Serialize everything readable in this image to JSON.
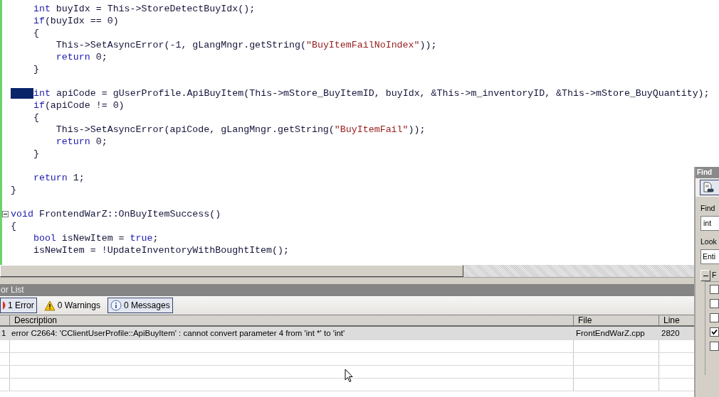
{
  "editor": {
    "lines": [
      {
        "segments": [
          {
            "kind": "keyword",
            "text": "    int"
          },
          {
            "kind": "plain",
            "text": " buyIdx = This->StoreDetectBuyIdx();"
          }
        ]
      },
      {
        "segments": [
          {
            "kind": "keyword",
            "text": "    if"
          },
          {
            "kind": "plain",
            "text": "(buyIdx == 0)"
          }
        ]
      },
      {
        "segments": [
          {
            "kind": "plain",
            "text": "    {"
          }
        ]
      },
      {
        "segments": [
          {
            "kind": "plain",
            "text": "        This->SetAsyncError(-1, gLangMngr.getString("
          },
          {
            "kind": "string",
            "text": "\"BuyItemFailNoIndex\""
          },
          {
            "kind": "plain",
            "text": "));"
          }
        ]
      },
      {
        "segments": [
          {
            "kind": "keyword",
            "text": "        return"
          },
          {
            "kind": "plain",
            "text": " 0;"
          }
        ]
      },
      {
        "segments": [
          {
            "kind": "plain",
            "text": "    }"
          }
        ]
      },
      {
        "kind": "blank"
      },
      {
        "selection": true,
        "segments": [
          {
            "kind": "keyword",
            "text": "int"
          },
          {
            "kind": "plain",
            "text": " apiCode = gUserProfile.ApiBuyItem(This->mStore_BuyItemID, buyIdx, &This->m_inventoryID, &This->mStore_BuyQuantity);"
          }
        ]
      },
      {
        "segments": [
          {
            "kind": "keyword",
            "text": "    if"
          },
          {
            "kind": "plain",
            "text": "(apiCode != 0)"
          }
        ]
      },
      {
        "segments": [
          {
            "kind": "plain",
            "text": "    {"
          }
        ]
      },
      {
        "segments": [
          {
            "kind": "plain",
            "text": "        This->SetAsyncError(apiCode, gLangMngr.getString("
          },
          {
            "kind": "string",
            "text": "\"BuyItemFail\""
          },
          {
            "kind": "plain",
            "text": "));"
          }
        ]
      },
      {
        "segments": [
          {
            "kind": "keyword",
            "text": "        return"
          },
          {
            "kind": "plain",
            "text": " 0;"
          }
        ]
      },
      {
        "segments": [
          {
            "kind": "plain",
            "text": "    }"
          }
        ]
      },
      {
        "kind": "blank"
      },
      {
        "segments": [
          {
            "kind": "keyword",
            "text": "    return"
          },
          {
            "kind": "plain",
            "text": " 1;"
          }
        ]
      },
      {
        "segments": [
          {
            "kind": "plain",
            "text": "}"
          }
        ]
      },
      {
        "kind": "blank"
      },
      {
        "fold": true,
        "segments": [
          {
            "kind": "keyword",
            "text": "void"
          },
          {
            "kind": "plain",
            "text": " FrontendWarZ::OnBuyItemSuccess()"
          }
        ]
      },
      {
        "segments": [
          {
            "kind": "plain",
            "text": "{"
          }
        ]
      },
      {
        "segments": [
          {
            "kind": "keyword",
            "text": "    bool"
          },
          {
            "kind": "plain",
            "text": " isNewItem = "
          },
          {
            "kind": "keyword",
            "text": "true"
          },
          {
            "kind": "plain",
            "text": ";"
          }
        ]
      },
      {
        "segments": [
          {
            "kind": "plain",
            "text": "    isNewItem = !UpdateInventoryWithBoughtItem();"
          }
        ]
      }
    ]
  },
  "error_list": {
    "title": "or List",
    "filters": [
      {
        "kind": "error",
        "label": "1 Error",
        "selected": true
      },
      {
        "kind": "warning",
        "label": "0 Warnings",
        "selected": false
      },
      {
        "kind": "info",
        "label": "0 Messages",
        "selected": true
      }
    ],
    "columns": [
      "Description",
      "File",
      "Line"
    ],
    "rows": [
      {
        "index": "1",
        "description": "error C2664: 'CClientUserProfile::ApiBuyItem' : cannot convert parameter 4 from 'int *' to 'int'",
        "file": "FrontEndWarZ.cpp",
        "line": "2820"
      }
    ]
  },
  "find_dialog": {
    "title": "Find",
    "find_label": "Find",
    "find_value": "int",
    "look_label": "Look",
    "look_value": "Enti",
    "section_label": "F",
    "options": [
      {
        "checked": false
      },
      {
        "checked": false
      },
      {
        "checked": false
      },
      {
        "checked": true
      },
      {
        "checked": false
      }
    ]
  }
}
